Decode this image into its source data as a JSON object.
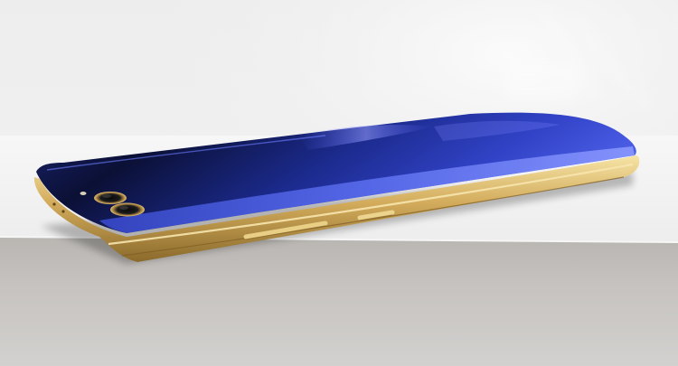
{
  "scene": {
    "subject": "smartphone-back",
    "palette": {
      "background_top": "#f3f3f3",
      "background_mid": "#e6e6e6",
      "surface_top": "#f4f4f4",
      "surface_front": "#bdbbb9",
      "frame_gold": "#caa14f",
      "frame_highlight": "#f3dd9a",
      "glass_dark": "#0c1440",
      "glass_blue": "#2b3fbf",
      "glass_edge": "#5b6cf0",
      "reflection": "#8a8fff"
    },
    "icons": [
      "dual-camera-icon",
      "flash-icon",
      "volume-button-icon",
      "power-button-icon"
    ]
  }
}
